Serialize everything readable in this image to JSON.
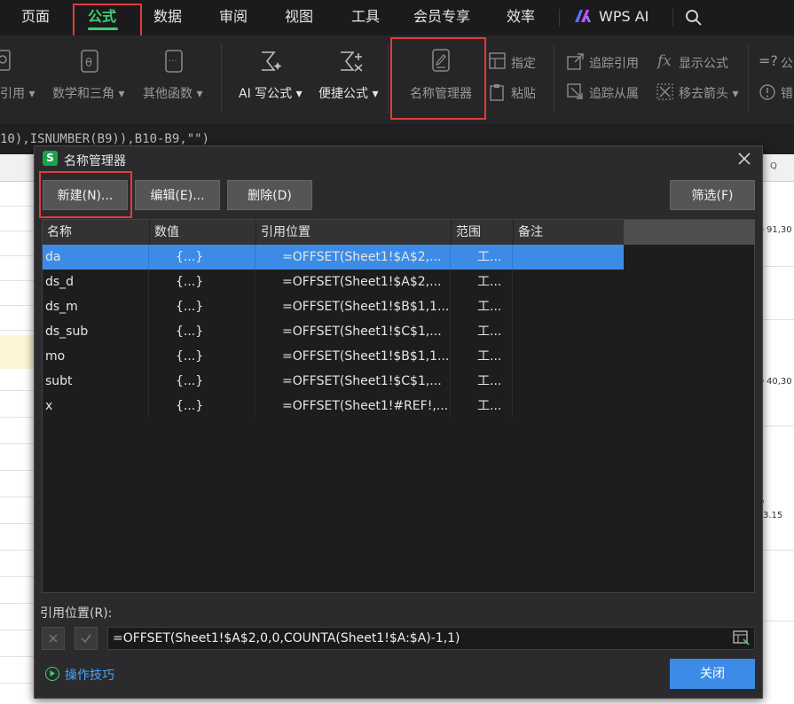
{
  "menu": {
    "items": [
      "页面",
      "公式",
      "数据",
      "审阅",
      "视图",
      "工具",
      "会员专享",
      "效率"
    ],
    "active": "公式",
    "wps_ai": "WPS AI"
  },
  "ribbon": {
    "ref_func": "引用",
    "math_trig": "数学和三角",
    "other_func": "其他函数",
    "ai_formula": "AI 写公式",
    "quick_formula": "便捷公式",
    "name_manager": "名称管理器",
    "specify": "指定",
    "paste": "粘贴",
    "trace_precedents": "追踪引用",
    "trace_dependents": "追踪从属",
    "show_formulas": "显示公式",
    "remove_arrows": "移去箭头",
    "formula_partial": "公",
    "error_partial": "错"
  },
  "formula_bar": {
    "text": "10),ISNUMBER(B9)),B10-B9,\"\")"
  },
  "sheet": {
    "col_q": "Q",
    "side_values": [
      "91,30",
      "40,30",
      "3.15"
    ]
  },
  "dialog": {
    "title": "名称管理器",
    "buttons": {
      "new": "新建(N)...",
      "edit": "编辑(E)...",
      "delete": "删除(D)",
      "filter": "筛选(F)",
      "close": "关闭"
    },
    "columns": [
      "名称",
      "数值",
      "引用位置",
      "范围",
      "备注"
    ],
    "rows": [
      {
        "name": "da",
        "value": "{...}",
        "ref": "=OFFSET(Sheet1!$A$2,...",
        "scope": "工...",
        "note": "",
        "selected": true
      },
      {
        "name": "ds_d",
        "value": "{...}",
        "ref": "=OFFSET(Sheet1!$A$2,...",
        "scope": "工...",
        "note": ""
      },
      {
        "name": "ds_m",
        "value": "{...}",
        "ref": "=OFFSET(Sheet1!$B$1,1...",
        "scope": "工...",
        "note": ""
      },
      {
        "name": "ds_sub",
        "value": "{...}",
        "ref": "=OFFSET(Sheet1!$C$1,...",
        "scope": "工...",
        "note": ""
      },
      {
        "name": "mo",
        "value": "{...}",
        "ref": "=OFFSET(Sheet1!$B$1,1...",
        "scope": "工...",
        "note": ""
      },
      {
        "name": "subt",
        "value": "{...}",
        "ref": "=OFFSET(Sheet1!$C$1,...",
        "scope": "工...",
        "note": ""
      },
      {
        "name": "x",
        "value": "{...}",
        "ref": "=OFFSET(Sheet1!#REF!,...",
        "scope": "工...",
        "note": ""
      }
    ],
    "ref_label": "引用位置(R):",
    "ref_value": "=OFFSET(Sheet1!$A$2,0,0,COUNTA(Sheet1!$A:$A)-1,1)",
    "tips": "操作技巧"
  },
  "colors": {
    "accent_green": "#3ecf6e",
    "selection_blue": "#3c8ce7",
    "highlight_red": "#e23b3b"
  }
}
